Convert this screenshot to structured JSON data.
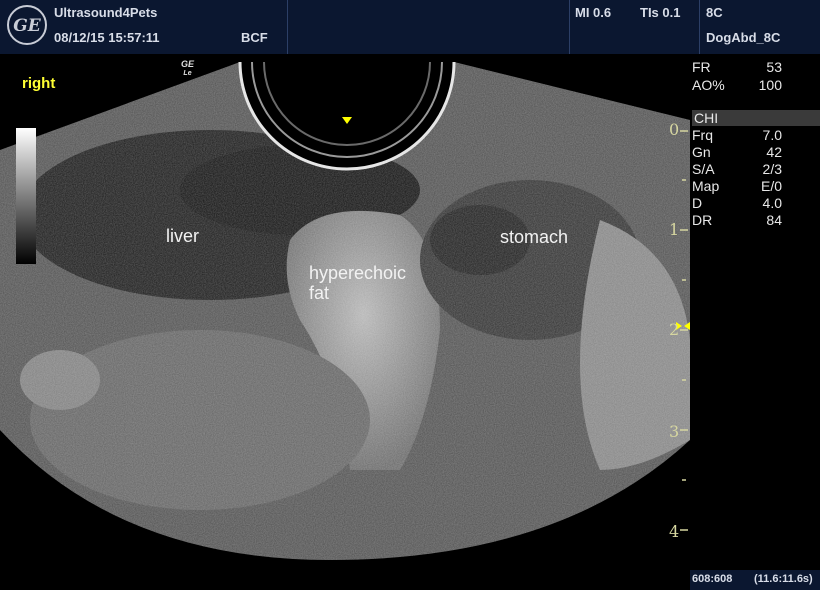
{
  "header": {
    "brand": "Ultrasound4Pets",
    "datetime": "08/12/15 15:57:11",
    "operator": "BCF",
    "mi": "MI 0.6",
    "tis": "TIs 0.1",
    "probe": "8C",
    "preset": "DogAbd_8C",
    "logo_text": "GE"
  },
  "image": {
    "orientation_label": "right",
    "probe_logo": "GE\nLe",
    "annotations": {
      "liver": "liver",
      "hyperechoic_line1": "hyperechoic",
      "hyperechoic_line2": "fat",
      "stomach": "stomach"
    }
  },
  "parameters": {
    "fr_label": "FR",
    "fr_value": "53",
    "ao_label": "AO%",
    "ao_value": "100",
    "mode": "CHI",
    "rows": [
      {
        "label": "Frq",
        "value": "7.0"
      },
      {
        "label": "Gn",
        "value": "42"
      },
      {
        "label": "S/A",
        "value": "2/3"
      },
      {
        "label": "Map",
        "value": "E/0"
      },
      {
        "label": "D",
        "value": "4.0"
      },
      {
        "label": "DR",
        "value": "84"
      }
    ]
  },
  "depth_scale": [
    "0",
    "1",
    "2",
    "3",
    "4"
  ],
  "footer": {
    "frames": "608:608",
    "time": "(11.6:11.6s)"
  },
  "colors": {
    "header_bg": "#0b1730",
    "orientation": "#ffff33",
    "focus_marker": "#ffff00"
  }
}
